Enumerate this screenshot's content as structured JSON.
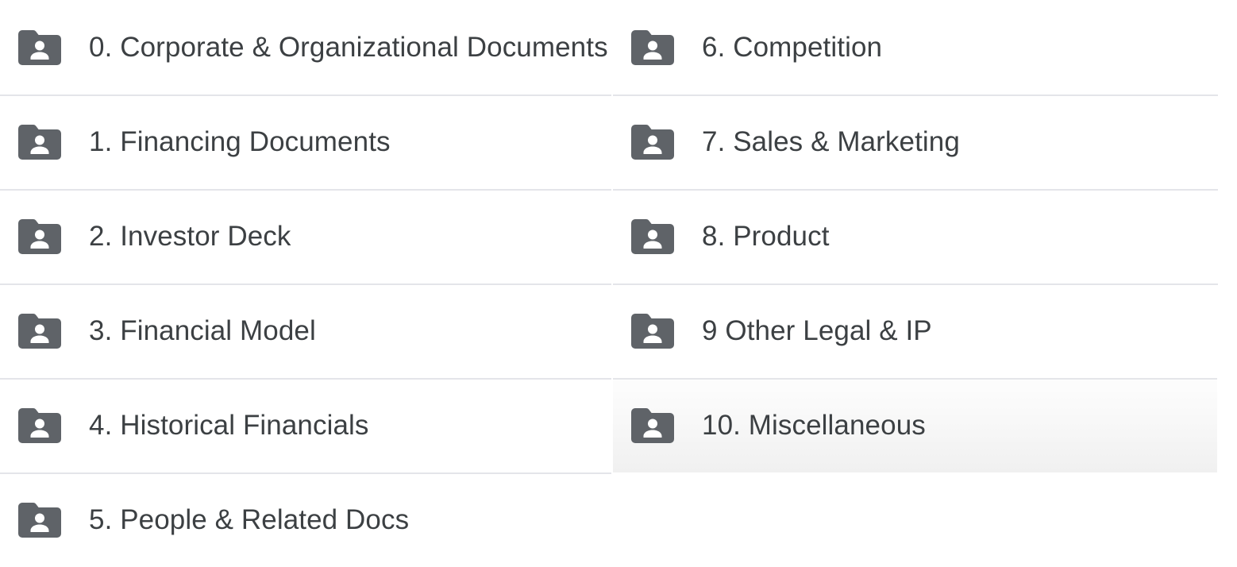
{
  "theme": {
    "background": "#ffffff",
    "folder_icon_color": "#5f6368",
    "label_color": "#3c4043",
    "divider_color": "#e4e5e9",
    "selected_row_background": "#f1f1f1"
  },
  "folder_list": {
    "icon_name": "shared-folder-icon",
    "columns": [
      {
        "name": "left-column",
        "items": [
          {
            "label": "0. Corporate & Organizational Documents",
            "selected": false
          },
          {
            "label": "1. Financing Documents",
            "selected": false
          },
          {
            "label": "2. Investor Deck",
            "selected": false
          },
          {
            "label": "3. Financial Model",
            "selected": false
          },
          {
            "label": "4. Historical Financials",
            "selected": false
          },
          {
            "label": "5. People & Related Docs",
            "selected": false
          }
        ]
      },
      {
        "name": "right-column",
        "items": [
          {
            "label": "6. Competition",
            "selected": false
          },
          {
            "label": "7. Sales & Marketing",
            "selected": false
          },
          {
            "label": "8. Product",
            "selected": false
          },
          {
            "label": "9 Other Legal & IP",
            "selected": false
          },
          {
            "label": "10. Miscellaneous",
            "selected": true
          }
        ]
      }
    ]
  }
}
